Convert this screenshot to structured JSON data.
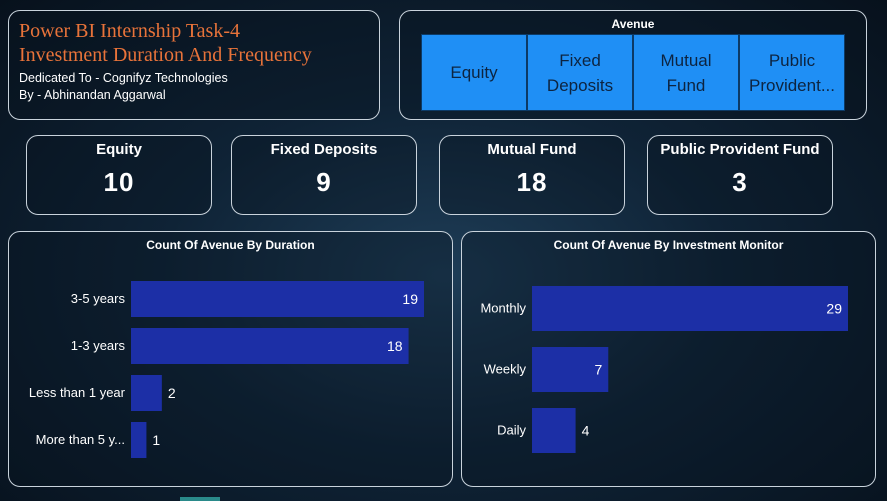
{
  "header": {
    "title_line1": "Power BI Internship Task-4",
    "title_line2": "Investment Duration And Frequency",
    "dedication": "Dedicated To - Cognifyz Technologies",
    "author": "By - Abhinandan Aggarwal"
  },
  "slicer": {
    "title": "Avenue",
    "options": [
      {
        "line1": "Equity",
        "line2": ""
      },
      {
        "line1": "Fixed",
        "line2": "Deposits"
      },
      {
        "line1": "Mutual",
        "line2": "Fund"
      },
      {
        "line1": "Public",
        "line2": "Provident..."
      }
    ]
  },
  "kpis": [
    {
      "label": "Equity",
      "value": "10"
    },
    {
      "label": "Fixed Deposits",
      "value": "9"
    },
    {
      "label": "Mutual Fund",
      "value": "18"
    },
    {
      "label": "Public Provident Fund",
      "value": "3"
    }
  ],
  "colors": {
    "bar": "#1c2fa6",
    "tile": "#1f8ff5",
    "title_accent": "#e8733a"
  },
  "chart_data": [
    {
      "type": "bar",
      "orientation": "horizontal",
      "title": "Count Of Avenue By Duration",
      "categories": [
        "3-5 years",
        "1-3 years",
        "Less than 1 year",
        "More than 5 y..."
      ],
      "values": [
        19,
        18,
        2,
        1
      ],
      "xlabel": "",
      "ylabel": "",
      "grid": false
    },
    {
      "type": "bar",
      "orientation": "horizontal",
      "title": "Count Of Avenue By Investment Monitor",
      "categories": [
        "Monthly",
        "Weekly",
        "Daily"
      ],
      "values": [
        29,
        7,
        4
      ],
      "xlabel": "",
      "ylabel": "",
      "grid": false
    }
  ]
}
